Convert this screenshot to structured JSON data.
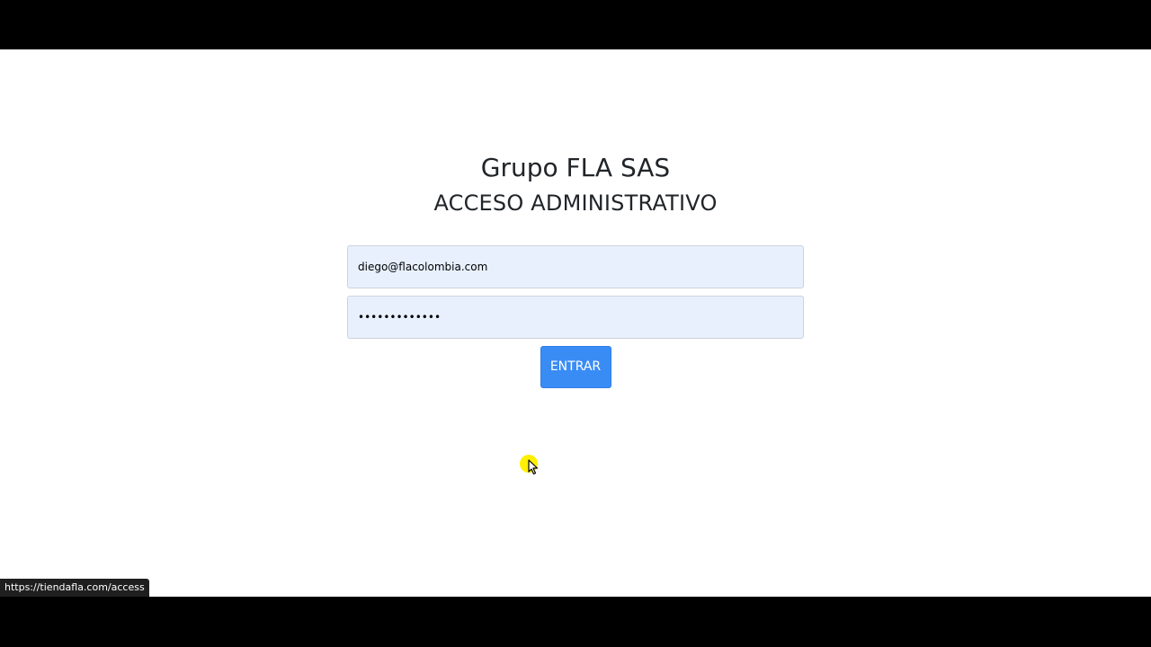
{
  "header": {
    "brand_title": "Grupo FLA SAS",
    "subtitle": "ACCESO ADMINISTRATIVO"
  },
  "login_form": {
    "email_value": "diego@flacolombia.com",
    "password_value": "•••••••••••••",
    "submit_label": "ENTRAR"
  },
  "status_bar": {
    "link_url": "https://tiendafla.com/access"
  },
  "colors": {
    "field_background": "#e8f0fe",
    "button_background": "#3a8cf5",
    "cursor_highlight": "#ffef00"
  },
  "icons": {
    "cursor": "mouse-pointer-icon"
  }
}
